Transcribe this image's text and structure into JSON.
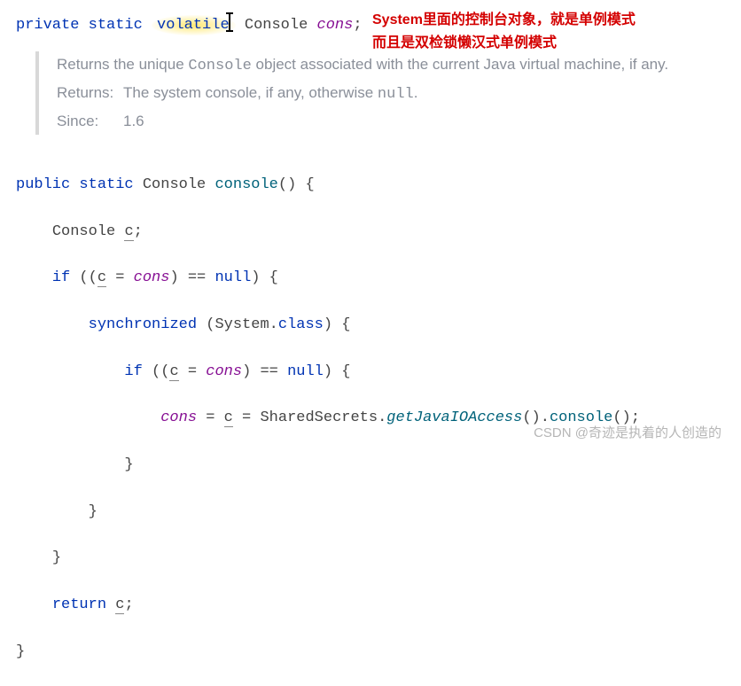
{
  "decl": {
    "kw_private": "private",
    "kw_static": "static",
    "kw_volatile": "volatile",
    "type": "Console",
    "field": "cons",
    "semi": ";"
  },
  "annotation": {
    "line1": "System里面的控制台对象，就是单例模式",
    "line2": "而且是双检锁懒汉式单例模式"
  },
  "doc": {
    "desc_pre": "Returns the unique ",
    "desc_type": "Console",
    "desc_post": " object associated with the current Java virtual machine, if any.",
    "returns_label": "Returns:",
    "returns_pre": "The system console, if any, otherwise ",
    "returns_null": "null",
    "returns_post": ".",
    "since_label": "Since:",
    "since_value": "1.6"
  },
  "code": {
    "l1_public": "public",
    "l1_static": "static",
    "l1_type": "Console",
    "l1_name": "console",
    "l1_parens": "() {",
    "l2_type": "Console ",
    "l2_var": "c",
    "l2_semi": ";",
    "l3_if": "if",
    "l3_open": " ((",
    "l3_c": "c",
    "l3_eq": " = ",
    "l3_cons": "cons",
    "l3_cmp": ") == ",
    "l3_null": "null",
    "l3_close": ") {",
    "l4_sync": "synchronized",
    "l4_open": " (System.",
    "l4_class": "class",
    "l4_close": ") {",
    "l5_if": "if",
    "l5_open": " ((",
    "l5_c": "c",
    "l5_eq": " = ",
    "l5_cons": "cons",
    "l5_cmp": ") == ",
    "l5_null": "null",
    "l5_close": ") {",
    "l6_cons": "cons",
    "l6_eq1": " = ",
    "l6_c": "c",
    "l6_eq2": " = SharedSecrets.",
    "l6_m1": "getJavaIOAccess",
    "l6_mid": "().",
    "l6_m2": "console",
    "l6_end": "();",
    "l7": "}",
    "l8": "}",
    "l9": "}",
    "l10_ret": "return",
    "l10_sp": " ",
    "l10_c": "c",
    "l10_semi": ";",
    "l11": "}"
  },
  "watermark": "CSDN @奇迹是执着的人创造的"
}
